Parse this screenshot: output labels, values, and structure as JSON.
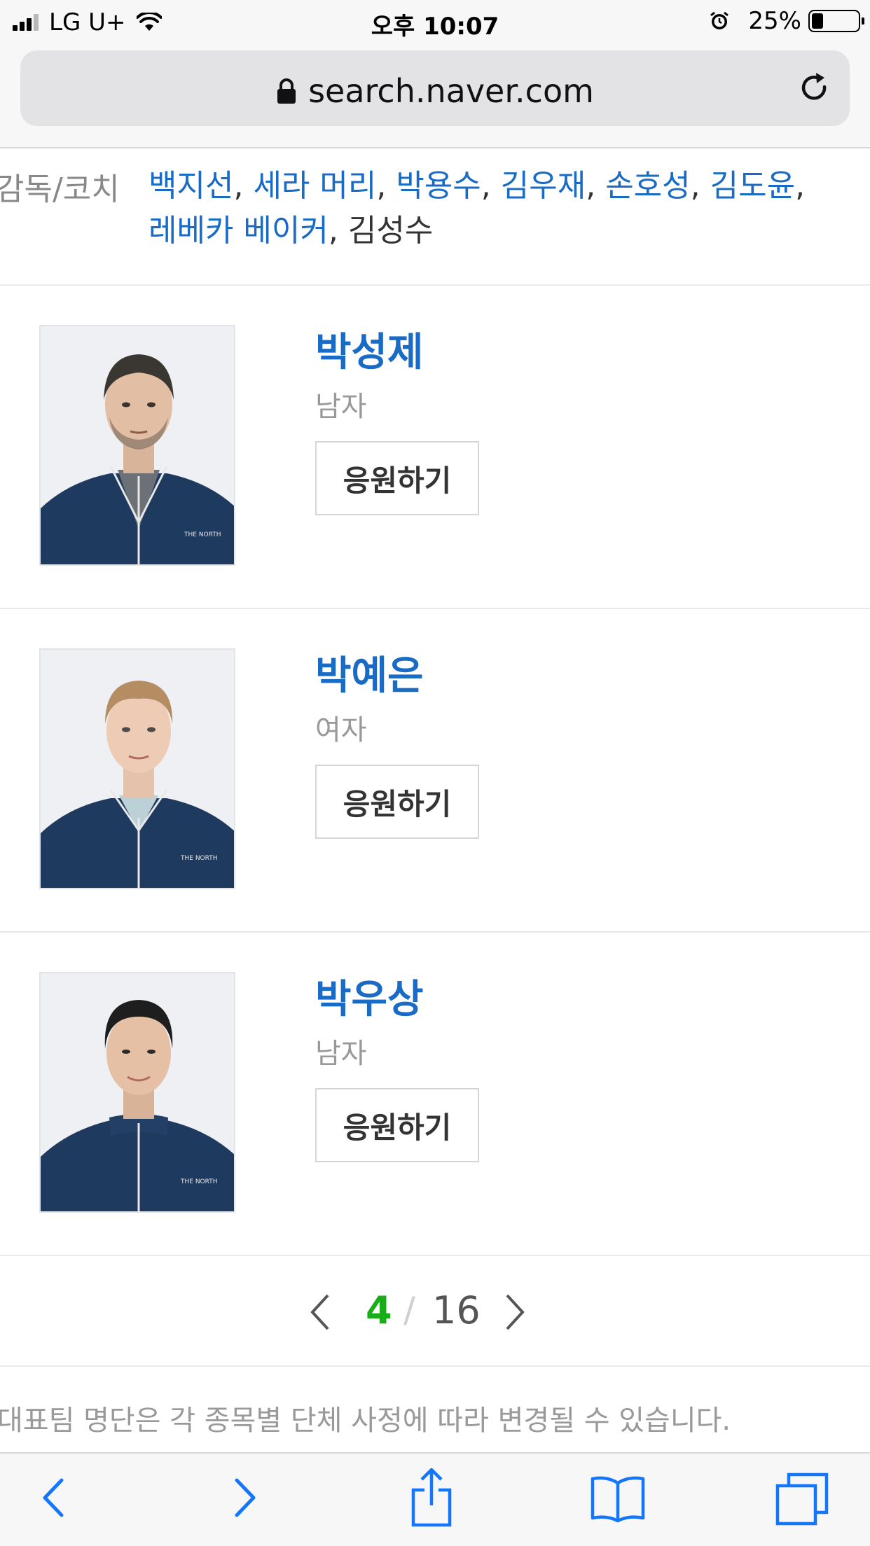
{
  "status_bar": {
    "carrier": "LG U+",
    "time": "오후 10:07",
    "battery": "25%",
    "battery_level": 0.25
  },
  "browser": {
    "url": "search.naver.com",
    "lock_icon": "lock-icon",
    "reload_icon": "reload-icon"
  },
  "coaches": {
    "label": "감독/코치",
    "names": [
      "백지선",
      "세라 머리",
      "박용수",
      "김우재",
      "손호성",
      "김도윤",
      "레베카 베이커"
    ],
    "last_name": "김성수",
    "separator": ", "
  },
  "players": [
    {
      "name": "박성제",
      "gender": "남자",
      "button": "응원하기"
    },
    {
      "name": "박예은",
      "gender": "여자",
      "button": "응원하기"
    },
    {
      "name": "박우상",
      "gender": "남자",
      "button": "응원하기"
    }
  ],
  "pagination": {
    "current": "4",
    "separator": "/",
    "total": "16"
  },
  "notice": "대표팀 명단은 각 종목별 단체 사정에 따라 변경될 수 있습니다.",
  "toolbar": {
    "icons": [
      "back-icon",
      "forward-icon",
      "share-icon",
      "bookmarks-icon",
      "tabs-icon"
    ]
  },
  "colors": {
    "link": "#1a6bc5",
    "page_current": "#19ad19",
    "jacket": "#1f3a5f"
  }
}
